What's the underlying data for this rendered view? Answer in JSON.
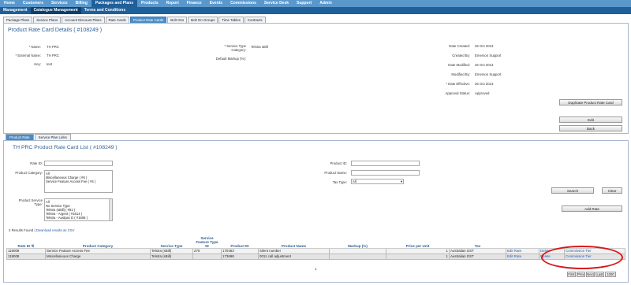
{
  "nav_primary": [
    "Home",
    "Customers",
    "Services",
    "Billing",
    "Packages and Plans",
    "Products",
    "Report",
    "Finance",
    "Events",
    "Commissions",
    "Service Desk",
    "Support",
    "Admin"
  ],
  "nav_primary_active": 4,
  "nav_secondary": [
    "Management",
    "Catalogue Management",
    "Terms and Conditions"
  ],
  "nav_secondary_active": 1,
  "tabs": [
    "Package Plans",
    "Service Plans",
    "Account Discount Plans",
    "Rate Cards",
    "Product Rate Cards",
    "Bolt Ons",
    "Bolt On Groups",
    "Time Tables",
    "Contracts"
  ],
  "tabs_active": 4,
  "details": {
    "title": "Product Rate Card Details ( #108249 )",
    "name_label": "* Name:",
    "name_value": "TH PRC",
    "external_label": "* External Name:",
    "external_value": "TH PRC",
    "key_label": "Key:",
    "key_value": "test",
    "service_type_label": "* Service Type Category:",
    "service_type_value": "Telstra sBill",
    "markup_label": "Default Markup (%):",
    "markup_value": "",
    "created_label": "Date Created:",
    "created_value": "26 Oct 2013",
    "created_by_label": "Created By:",
    "created_by_value": "Emerson Support",
    "modified_label": "Date Modified:",
    "modified_value": "26 Oct 2013",
    "modified_by_label": "Modified By:",
    "modified_by_value": "Emerson Support",
    "effective_label": "* Date Effective:",
    "effective_value": "26 Oct 2013",
    "approval_label": "Approval Status:",
    "approval_value": "Approved",
    "btn_duplicate": "Duplicate Product Rate Card",
    "btn_edit": "Edit",
    "btn_back": "Back"
  },
  "sub_tabs": [
    "Product Rate",
    "Service Plan Links"
  ],
  "list": {
    "title": "TH PRC Product Rate Card List ( #108249 )",
    "rate_id_label": "Rate ID:",
    "category_label": "Product Category:",
    "category_options": [
      "All",
      "Miscellaneous Charge ( #6 )",
      "Service Feature Access Fee ( #4 )"
    ],
    "service_type_label": "Product Service Type:",
    "service_type_options": [
      "All",
      "No Service Type",
      "Telstra (sBill) ( #81 )",
      "Telstra - Argent ( #1614 )",
      "Telstra - Austpac D ( #1606 )"
    ],
    "product_id_label": "Product ID:",
    "product_name_label": "Product Name:",
    "tax_type_label": "Tax Type:",
    "tax_type_value": "All",
    "btn_search": "Search",
    "btn_clear": "Clear",
    "btn_add": "Add Rate",
    "results_text": "2 Results Found",
    "download_link": "Download results as CSV",
    "columns": [
      "Rate ID ⇅",
      "Product Category",
      "Service Type",
      "Service Feature Type ID",
      "Product ID",
      "Product Name",
      "Markup (%)",
      "Price per Unit",
      "Tax",
      "",
      "",
      ""
    ],
    "rows": [
      {
        "rate_id": "119009",
        "category": "Service Feature Access Fee",
        "service_type": "Telstra (sBill)",
        "feature_id": "270",
        "product_id": "170453",
        "product_name": "Silent number",
        "markup": "",
        "price": "1",
        "tax": "Australian GST",
        "edit": "Edit Rate",
        "delete": "Delete",
        "tier": "Commission Tier"
      },
      {
        "rate_id": "119008",
        "category": "Miscellaneous Charge",
        "service_type": "Telstra (sBill)",
        "feature_id": "",
        "product_id": "173698",
        "product_name": "0011 call adjustment",
        "markup": "",
        "price": "1",
        "tax": "Australian GST",
        "edit": "Edit Rate",
        "delete": "Delete",
        "tier": "Commission Tier"
      }
    ],
    "page_number": "1",
    "pager": [
      "First",
      "Prev",
      "Next",
      "Last",
      "1000"
    ]
  }
}
